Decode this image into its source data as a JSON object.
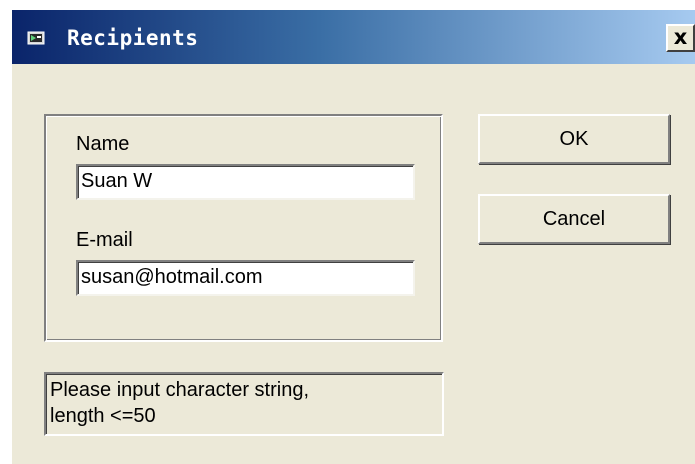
{
  "window": {
    "title": "Recipients",
    "close_label": "x",
    "icon": "app-window-icon"
  },
  "form": {
    "name_label": "Name",
    "name_value": "Suan W",
    "email_label": "E-mail",
    "email_value": "susan@hotmail.com"
  },
  "buttons": {
    "ok_label": "OK",
    "cancel_label": "Cancel"
  },
  "status": {
    "line1": "Please input character string,",
    "line2": "length <=50"
  },
  "colors": {
    "titlebar_start": "#0a246a",
    "titlebar_end": "#a6caf0",
    "dialog_face": "#ece9d8"
  }
}
